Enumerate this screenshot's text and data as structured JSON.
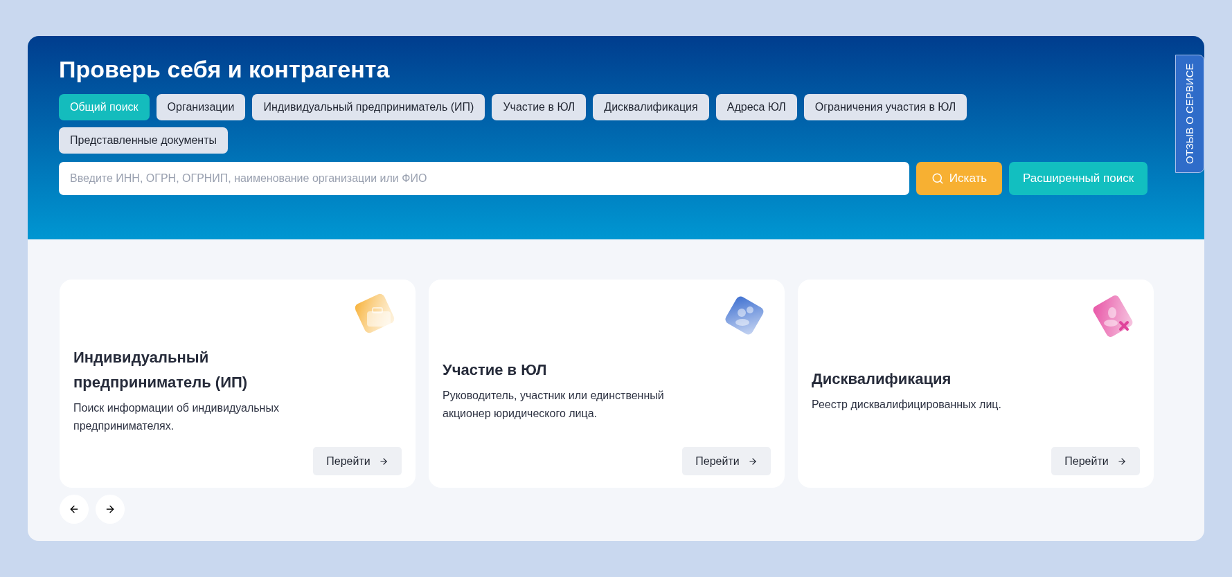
{
  "header": {
    "title": "Проверь себя и контрагента"
  },
  "tabs": [
    {
      "label": "Общий поиск",
      "selected": true
    },
    {
      "label": "Организации",
      "selected": false
    },
    {
      "label": "Индивидуальный предприниматель (ИП)",
      "selected": false
    },
    {
      "label": "Участие в ЮЛ",
      "selected": false
    },
    {
      "label": "Дисквалификация",
      "selected": false
    },
    {
      "label": "Адреса ЮЛ",
      "selected": false
    },
    {
      "label": "Ограничения участия в ЮЛ",
      "selected": false
    },
    {
      "label": "Представленные документы",
      "selected": false
    }
  ],
  "search": {
    "placeholder": "Введите ИНН, ОГРН, ОГРНИП, наименование организации или ФИО",
    "search_button": "Искать",
    "advanced_button": "Расширенный поиск"
  },
  "feedback_tab": "ОТЗЫВ О СЕРВИСЕ",
  "cards": [
    {
      "title": "Индивидуальный предприниматель (ИП)",
      "description": "Поиск информации об индивидуальных предпринимателях.",
      "button": "Перейти"
    },
    {
      "title": "Участие в ЮЛ",
      "description": "Руководитель, участник или единственный акционер юридического лица.",
      "button": "Перейти"
    },
    {
      "title": "Дисквалификация",
      "description": "Реестр дисквалифицированных лиц.",
      "button": "Перейти"
    }
  ]
}
